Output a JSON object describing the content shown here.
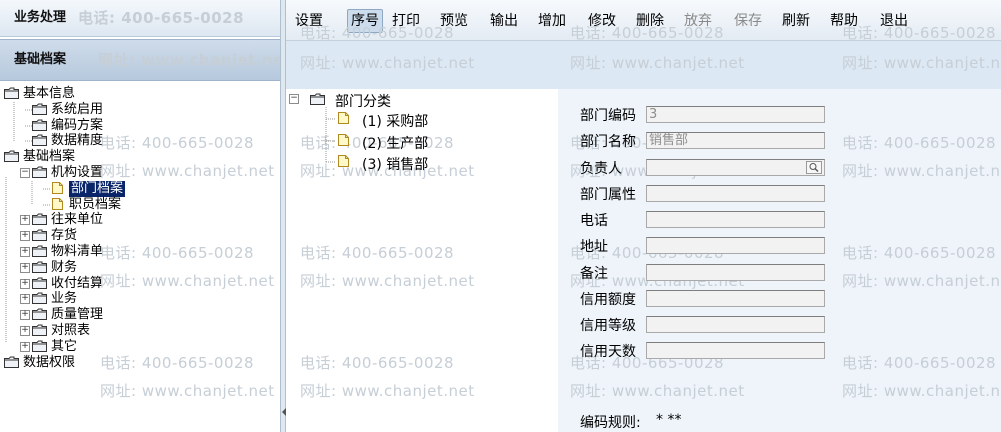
{
  "left_panel": {
    "header1": "业务处理",
    "header2": "基础档案",
    "tree": [
      {
        "label": "基本信息",
        "level": 0,
        "type": "folder"
      },
      {
        "label": "系统启用",
        "level": 1,
        "type": "folder"
      },
      {
        "label": "编码方案",
        "level": 1,
        "type": "folder"
      },
      {
        "label": "数据精度",
        "level": 1,
        "type": "folder"
      },
      {
        "label": "基础档案",
        "level": 0,
        "type": "folder"
      },
      {
        "label": "机构设置",
        "level": 1,
        "type": "folder",
        "expander": "-"
      },
      {
        "label": "部门档案",
        "level": 2,
        "type": "doc",
        "selected": true
      },
      {
        "label": "职员档案",
        "level": 2,
        "type": "doc"
      },
      {
        "label": "往来单位",
        "level": 1,
        "type": "folder",
        "expander": "+"
      },
      {
        "label": "存货",
        "level": 1,
        "type": "folder",
        "expander": "+"
      },
      {
        "label": "物料清单",
        "level": 1,
        "type": "folder",
        "expander": "+"
      },
      {
        "label": "财务",
        "level": 1,
        "type": "folder",
        "expander": "+"
      },
      {
        "label": "收付结算",
        "level": 1,
        "type": "folder",
        "expander": "+"
      },
      {
        "label": "业务",
        "level": 1,
        "type": "folder",
        "expander": "+"
      },
      {
        "label": "质量管理",
        "level": 1,
        "type": "folder",
        "expander": "+"
      },
      {
        "label": "对照表",
        "level": 1,
        "type": "folder",
        "expander": "+"
      },
      {
        "label": "其它",
        "level": 1,
        "type": "folder",
        "expander": "+"
      },
      {
        "label": "数据权限",
        "level": 0,
        "type": "folder"
      }
    ]
  },
  "toolbar": {
    "items": [
      {
        "label": "设置",
        "state": "normal"
      },
      {
        "label": "序号",
        "state": "active"
      },
      {
        "label": "打印",
        "state": "normal"
      },
      {
        "label": "预览",
        "state": "normal"
      },
      {
        "label": "输出",
        "state": "normal"
      },
      {
        "label": "增加",
        "state": "normal"
      },
      {
        "label": "修改",
        "state": "normal"
      },
      {
        "label": "删除",
        "state": "normal"
      },
      {
        "label": "放弃",
        "state": "disabled"
      },
      {
        "label": "保存",
        "state": "disabled"
      },
      {
        "label": "刷新",
        "state": "normal"
      },
      {
        "label": "帮助",
        "state": "normal"
      },
      {
        "label": "退出",
        "state": "normal"
      }
    ]
  },
  "dept_tree": {
    "root": "部门分类",
    "children": [
      "(1) 采购部",
      "(2) 生产部",
      "(3) 销售部"
    ]
  },
  "form": {
    "fields": [
      {
        "label": "部门编码",
        "value": "3"
      },
      {
        "label": "部门名称",
        "value": "销售部"
      },
      {
        "label": "负责人",
        "value": "",
        "lookup": true
      },
      {
        "label": "部门属性",
        "value": ""
      },
      {
        "label": "电话",
        "value": ""
      },
      {
        "label": "地址",
        "value": ""
      },
      {
        "label": "备注",
        "value": ""
      },
      {
        "label": "信用额度",
        "value": ""
      },
      {
        "label": "信用等级",
        "value": ""
      },
      {
        "label": "信用天数",
        "value": ""
      }
    ],
    "code_rule_label": "编码规则:",
    "code_rule_value": "* **"
  },
  "watermark": {
    "phone": "电话: 400-665-0028",
    "site": "网址: www.chanjet.net"
  },
  "colors": {
    "selection": "#0a246a",
    "header_band": "#dce8f4",
    "form_background": "#eef4fa"
  }
}
